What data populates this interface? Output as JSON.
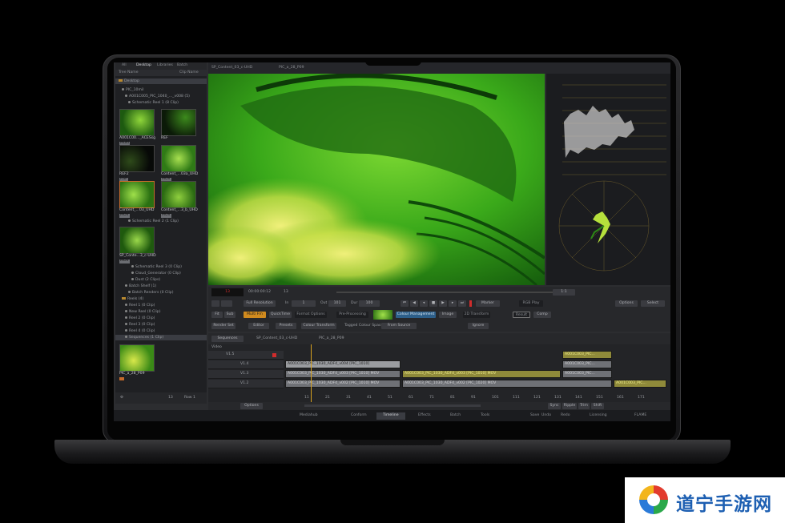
{
  "left_panel": {
    "tabs": [
      "All",
      "Desktop",
      "Libraries",
      "Batch"
    ],
    "active_tab": "Desktop",
    "column_headers": [
      "Tree Name",
      "Clip Name"
    ],
    "tree": [
      {
        "label": "Desktop",
        "level": 0,
        "kind": "folder",
        "highlight": true
      },
      {
        "label": "PIC_10mil",
        "level": 1,
        "kind": "bullet"
      },
      {
        "label": "A001C005_PIC_1040_..._v008 (5)",
        "level": 2,
        "kind": "bullet"
      },
      {
        "label": "Schematic Reel 1 (8 Clip)",
        "level": 3,
        "kind": "bullet"
      }
    ],
    "thumbs": [
      {
        "label": "A001C00..._ACESsg",
        "badge": "Multi"
      },
      {
        "label": "REF",
        "badge": ""
      },
      {
        "label": "REF2",
        "badge": "RSP"
      },
      {
        "label": "Content_...03a_UHD",
        "badge": "MOV"
      },
      {
        "label": "Content_...03_UHD",
        "badge": "MOV"
      },
      {
        "label": "Content_...3_b_UHD",
        "badge": "MOV"
      }
    ],
    "tree2": [
      {
        "label": "Schematic Reel 2 (1 Clip)"
      }
    ],
    "thumb_mid": {
      "label": "SP_Conte...3_c-UHD",
      "badge": "MOV"
    },
    "tree3": [
      {
        "label": "Schematic Reel 3 (0 Clip)"
      },
      {
        "label": "Cloud_Generator (0 Clip)"
      },
      {
        "label": "Dust (2 Clips)"
      },
      {
        "label": "Batch Shelf (1)"
      },
      {
        "label": "Batch Renders (0 Clip)"
      },
      {
        "label": "Reels (4)"
      },
      {
        "label": "Reel 1 (0 Clip)"
      },
      {
        "label": "New Reel (0 Clip)"
      },
      {
        "label": "Reel 2 (0 Clip)"
      },
      {
        "label": "Reel 3 (0 Clip)"
      },
      {
        "label": "Reel 4 (0 Clip)"
      },
      {
        "label": "Sequences (1 Clip)"
      }
    ],
    "thumb_bottom": {
      "label": "PIC_a_28_P09",
      "badge": ""
    },
    "bottom": {
      "left": "13",
      "right": "Row 1"
    }
  },
  "viewer": {
    "tabs": [
      "SP_Content_03_c-UHD",
      "PIC_a_28_P09"
    ]
  },
  "transport": {
    "timecode_red": "13",
    "timecode": "00:00:00:12",
    "frame": "13",
    "resolution": "Full Resolution",
    "in": "In",
    "in_val": "1",
    "out": "Out",
    "out_val": "101",
    "dur": "Dur",
    "dur_val": "100",
    "marker": "Marker",
    "rgb": "RGB Play",
    "zoom": "1:1",
    "options": "Options",
    "select": "Select"
  },
  "format_bar": {
    "buttons": [
      "Fit",
      "Sub"
    ],
    "multi": "Multi Fm",
    "quicktime": "QuickTime",
    "format_options": "Format Options",
    "pre_processing": "Pre-Processing",
    "colour_management": "Colour Management",
    "image": "Image",
    "transform": "2D Transform",
    "result": "Result",
    "comp": "Comp"
  },
  "colour_bar": {
    "render_set": "Render Set",
    "editor": "Editor",
    "presets": "Presets",
    "colour_transform": "Colour Transform",
    "tagged": "Tagged Colour Space",
    "from_source": "From Source",
    "ignore": "Ignore"
  },
  "timeline": {
    "seq_label": "Sequences",
    "seq_tabs": [
      "SP_Content_03_c-UHD",
      "PIC_a_28_P09"
    ],
    "video_label": "Video",
    "tracks": [
      "V1.5",
      "V1.4",
      "V1.3",
      "V1.2"
    ],
    "clips": {
      "v14a": "A001C003_PIC_1030_ADF4_v004 [PIC_1010]",
      "v14b": "A001C003_PIC...",
      "v15b": "A001C003_PIC...",
      "v13a": "A001C003_PIC_1030_ADF4_v003 [PIC_1010] MOV",
      "v13b": "A001C003_PIC_1030_ADF4_v003 [PIC_1010] MOV",
      "v13c": "A001C003_PIC...",
      "v12a": "A001C003_PIC_1030_ADF4_v002 [PIC_1010] MOV",
      "v12b": "A001C003_PIC_1030_ADF4_v002 [PIC_1020] MOV",
      "v12c": "A001C003_PIC..."
    },
    "ruler": [
      "11",
      "21",
      "31",
      "41",
      "51",
      "61",
      "71",
      "81",
      "91",
      "101",
      "111",
      "121",
      "131",
      "141",
      "151",
      "161",
      "171"
    ],
    "footer": {
      "options": "Options",
      "sync": "Sync",
      "ripple": "Ripple",
      "trim": "Trim",
      "shift": "Shift"
    }
  },
  "bottom_tabs": {
    "tabs": [
      "Mediahub",
      "Conform",
      "Timeline",
      "Effects",
      "Batch",
      "Tools"
    ],
    "active": "Timeline",
    "right": [
      "Save",
      "Undo",
      "Redo",
      "Licensing",
      "FLAME"
    ]
  },
  "watermark": {
    "text": "道宁手游网",
    "logo": "swirl-logo"
  },
  "colors": {
    "accent_orange": "#d08a1e",
    "accent_blue": "#2d5f8a",
    "clip_gold": "#8f8a3a",
    "image_green": "#3cb81e",
    "watermark_blue": "#1d5fb2"
  }
}
